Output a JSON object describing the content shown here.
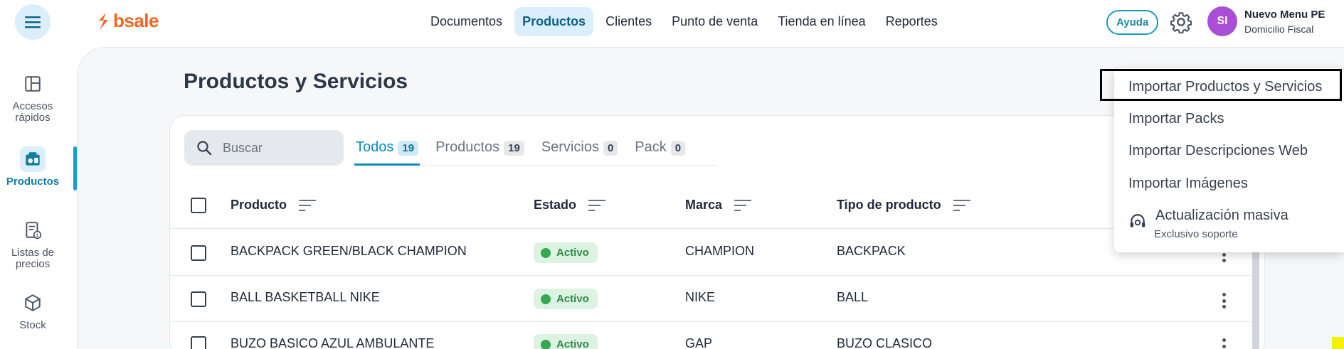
{
  "header": {
    "logo_text": "bsale",
    "nav": [
      {
        "label": "Documentos"
      },
      {
        "label": "Productos"
      },
      {
        "label": "Clientes"
      },
      {
        "label": "Punto de venta"
      },
      {
        "label": "Tienda en línea"
      },
      {
        "label": "Reportes"
      }
    ],
    "active_nav": "Productos",
    "help_label": "Ayuda",
    "user_initials": "SI",
    "user_name": "Nuevo Menu PE",
    "user_sub": "Domicilio Fiscal"
  },
  "sidebar": {
    "items": [
      {
        "label": "Accesos rápidos",
        "icon": "layout-grid-icon"
      },
      {
        "label": "Productos",
        "icon": "products-icon"
      },
      {
        "label": "Listas de precios",
        "icon": "price-list-icon"
      },
      {
        "label": "Stock",
        "icon": "box-icon"
      }
    ],
    "active": "Productos"
  },
  "main": {
    "title": "Productos y Servicios",
    "search_placeholder": "Buscar",
    "tabs": [
      {
        "label": "Todos",
        "count": "19"
      },
      {
        "label": "Productos",
        "count": "19"
      },
      {
        "label": "Servicios",
        "count": "0"
      },
      {
        "label": "Pack",
        "count": "0"
      }
    ],
    "active_tab": "Todos",
    "columns": [
      "Producto",
      "Estado",
      "Marca",
      "Tipo de producto"
    ],
    "rows": [
      {
        "producto": "BACKPACK GREEN/BLACK CHAMPION",
        "estado": "Activo",
        "marca": "CHAMPION",
        "tipo": "BACKPACK"
      },
      {
        "producto": "BALL BASKETBALL NIKE",
        "estado": "Activo",
        "marca": "NIKE",
        "tipo": "BALL"
      },
      {
        "producto": "BUZO BASICO AZUL AMBULANTE",
        "estado": "Activo",
        "marca": "GAP",
        "tipo": "BUZO CLASICO"
      }
    ]
  },
  "menu": {
    "items": [
      {
        "label": "Importar Productos y Servicios"
      },
      {
        "label": "Importar Packs"
      },
      {
        "label": "Importar Descripciones Web"
      },
      {
        "label": "Importar Imágenes"
      }
    ],
    "special_item": {
      "label": "Actualización masiva",
      "sub": "Exclusivo soporte",
      "icon": "support-headset-icon"
    }
  },
  "colors": {
    "accent": "#0f8ab8",
    "brand": "#f26522",
    "avatar": "#a94fd6",
    "status_active": "#36a852"
  }
}
